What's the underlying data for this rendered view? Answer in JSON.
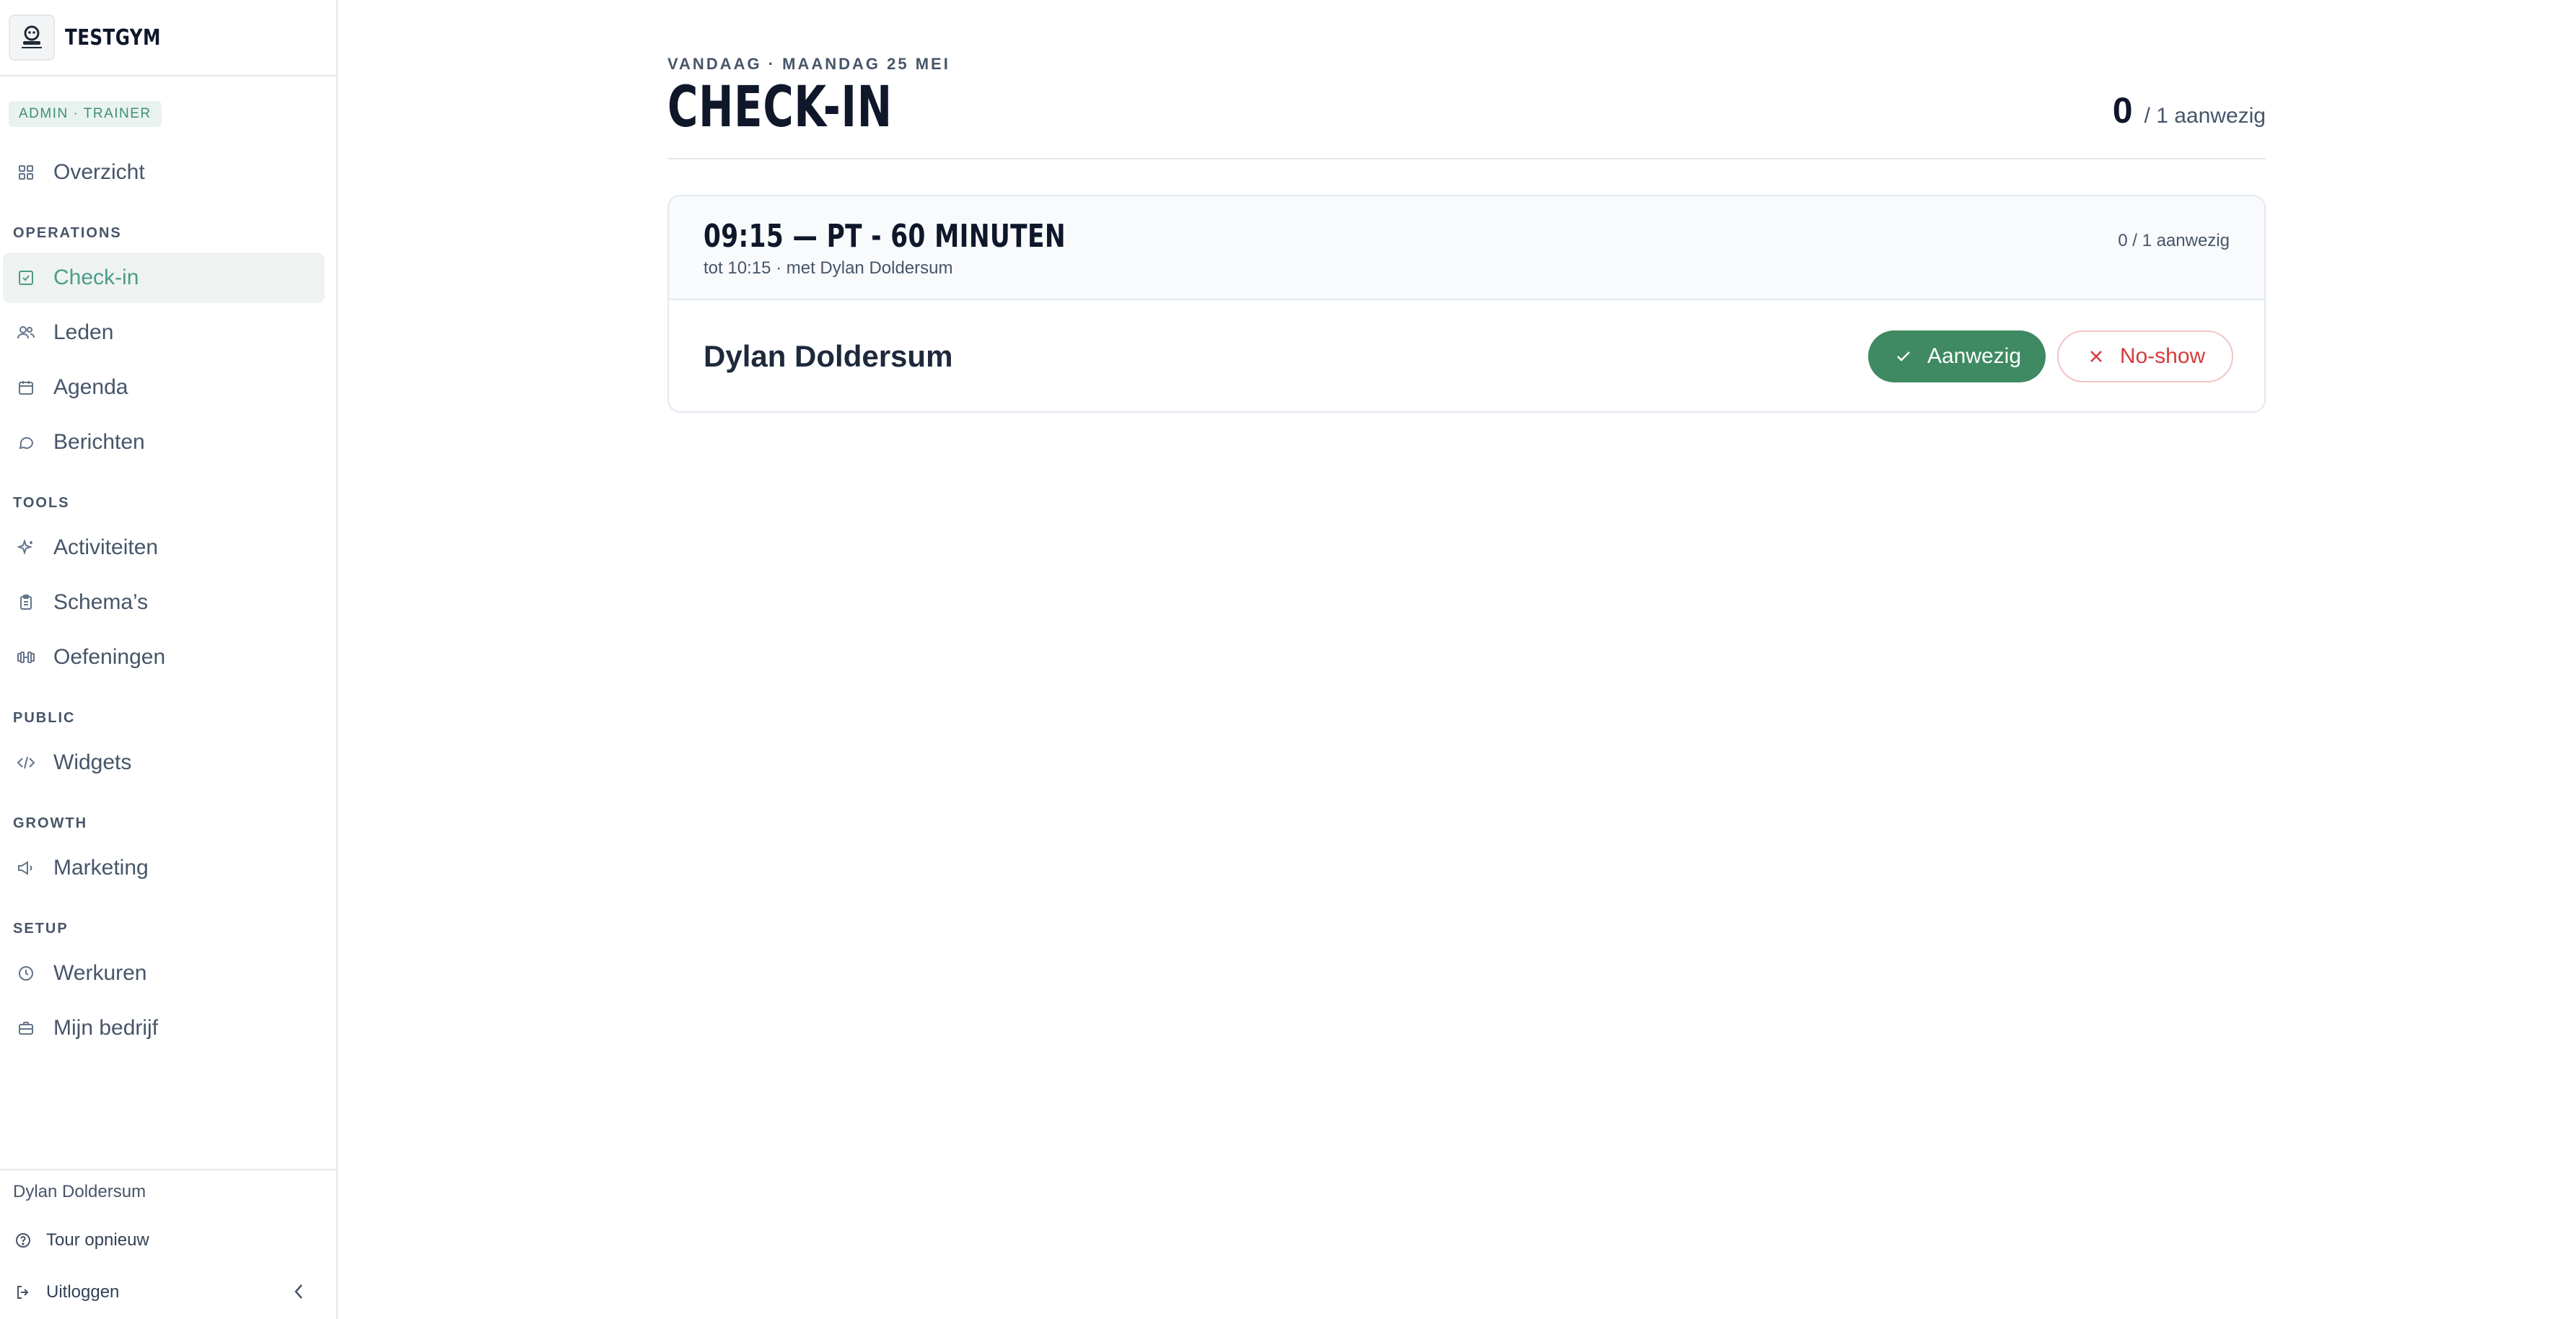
{
  "app": {
    "brand": "TESTGYM",
    "role_badge": "ADMIN · TRAINER"
  },
  "sidebar": {
    "overview": {
      "label": "Overzicht",
      "icon": "grid-icon"
    },
    "sections": [
      {
        "title": "OPERATIONS",
        "items": [
          {
            "label": "Check-in",
            "icon": "check-square-icon",
            "active": true
          },
          {
            "label": "Leden",
            "icon": "users-icon"
          },
          {
            "label": "Agenda",
            "icon": "calendar-icon"
          },
          {
            "label": "Berichten",
            "icon": "message-icon"
          }
        ]
      },
      {
        "title": "TOOLS",
        "items": [
          {
            "label": "Activiteiten",
            "icon": "sparkle-icon"
          },
          {
            "label": "Schema’s",
            "icon": "clipboard-icon"
          },
          {
            "label": "Oefeningen",
            "icon": "dumbbell-icon"
          }
        ]
      },
      {
        "title": "PUBLIC",
        "items": [
          {
            "label": "Widgets",
            "icon": "code-icon"
          }
        ]
      },
      {
        "title": "GROWTH",
        "items": [
          {
            "label": "Marketing",
            "icon": "megaphone-icon"
          }
        ]
      },
      {
        "title": "SETUP",
        "items": [
          {
            "label": "Werkuren",
            "icon": "clock-icon"
          },
          {
            "label": "Mijn bedrijf",
            "icon": "briefcase-icon"
          }
        ]
      }
    ],
    "footer": {
      "user": "Dylan Doldersum",
      "tour": "Tour opnieuw",
      "logout": "Uitloggen"
    }
  },
  "main": {
    "date_line": "VANDAAG · MAANDAG 25 MEI",
    "title": "CHECK-IN",
    "present_count": "0",
    "present_total": "/ 1 aanwezig",
    "session": {
      "title": "09:15 — PT - 60 MINUTEN",
      "subtitle": "tot 10:15 · met Dylan Doldersum",
      "count": "0 / 1 aanwezig",
      "attendee": "Dylan Doldersum",
      "present_label": "Aanwezig",
      "noshow_label": "No-show"
    }
  },
  "colors": {
    "accent": "#4b9d86",
    "present": "#3f8a62",
    "noshow": "#d63b3b"
  }
}
